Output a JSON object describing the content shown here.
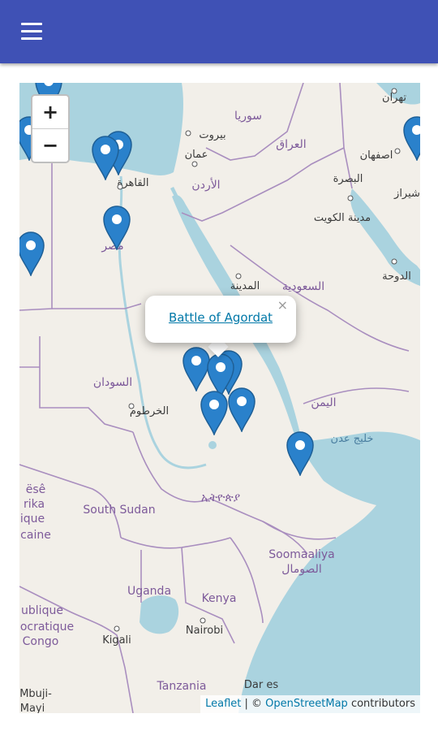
{
  "app_bar": {
    "menu_icon": "menu-icon",
    "color": "#3f51b5"
  },
  "map": {
    "zoom_in_label": "+",
    "zoom_out_label": "−",
    "popup": {
      "link_text": "Battle of Agordat",
      "close_label": "×"
    },
    "attribution": {
      "leaflet": "Leaflet",
      "separator": " | © ",
      "osm": "OpenStreetMap",
      "suffix": " contributors"
    },
    "place_labels": {
      "syria": "سوريا",
      "beirut": "بيروت",
      "iraq": "العراق",
      "tehran": "تهران",
      "isfahan": "اصفهان",
      "amman": "عمان",
      "cairo": "القاهرة",
      "jordan": "الأردن",
      "basra": "البصرة",
      "shiraz": "شیراز",
      "kuwait": "مدينة الكويت",
      "egypt": "مصر",
      "doha": "الدوحة",
      "medina": "المدينة",
      "saudi": "السعودية",
      "sudan": "السودان",
      "khartoum": "الخرطوم",
      "yemen": "اليمن",
      "gulf": "خليج عدن",
      "ethiopia": "ኢትዮጵያ",
      "sesotho_fragment": "ësê",
      "afrika_fragment": "rika",
      "ique_fragment": "ique",
      "caine_fragment": "caine",
      "south_sudan": "South Sudan",
      "somalia_latin": "Soomaaliya",
      "somalia_arabic": "الصومال",
      "uganda": "Uganda",
      "kenya": "Kenya",
      "publique_fragment": "ublique",
      "ocratique_fragment": "ocratique",
      "congo_fragment": "Congo",
      "kigali": "Kigali",
      "nairobi": "Nairobi",
      "tanzania": "Tanzania",
      "dar_fragment": "Dar es",
      "mbuji_fragment": "Mbuji-",
      "mayi_fragment": "Mayi"
    },
    "colors": {
      "water": "#aad3df",
      "land": "#f2efe9",
      "border": "#a98ebf",
      "marker": "#2a81cb",
      "link": "#0078a8"
    },
    "marker_icon": "map-marker-icon"
  }
}
